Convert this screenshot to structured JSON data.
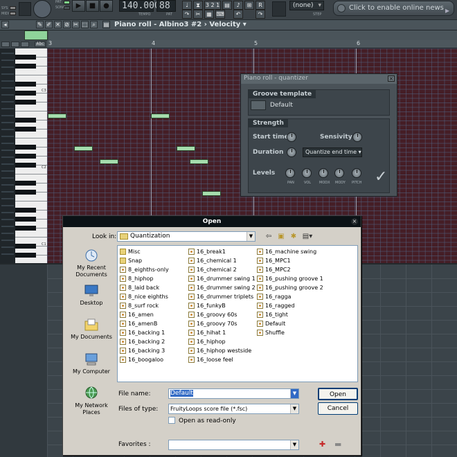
{
  "toolbar": {
    "labels": [
      "SYS",
      "MIDI",
      "PAT",
      "SONG",
      "TEMPO",
      "PAT"
    ],
    "tempo": "140.000",
    "pattern": "88",
    "pattern_tool_label": "3 2 1",
    "pattern_tool_label2": "R",
    "controller_select": "(none)",
    "news": "Click to enable online news",
    "step_label": "STEP"
  },
  "piano_roll": {
    "title": "Piano roll - Albino3 #2",
    "target": "Velocity",
    "bar_numbers": [
      "3",
      "4",
      "5",
      "6"
    ],
    "octave_labels": [
      "C3",
      "C2",
      "C1"
    ],
    "snap_label": "Abc",
    "accent_color": "#a6dcad"
  },
  "quantizer": {
    "title": "Piano roll - quantizer",
    "groove_header": "Groove template",
    "groove_value": "Default",
    "strength_header": "Strength",
    "start_time": "Start time",
    "sensivity": "Sensivity",
    "duration": "Duration",
    "quantize_mode": "Quantize end time",
    "levels": "Levels",
    "knob_labels": [
      "PAN",
      "VOL",
      "MODX",
      "MODY",
      "PITCH"
    ],
    "confirm_icon": "checkmark-icon"
  },
  "open_dialog": {
    "title": "Open",
    "look_in_label": "Look in:",
    "look_in_value": "Quantization",
    "places": [
      "My Recent Documents",
      "Desktop",
      "My Documents",
      "My Computer",
      "My Network Places"
    ],
    "columns": [
      [
        "Misc",
        "Snap",
        "8_eighths-only",
        "8_hiphop",
        "8_laid back",
        "8_nice eighths",
        "8_surf rock",
        "16_amen",
        "16_amenB",
        "16_backing 1",
        "16_backing 2",
        "16_backing 3",
        "16_boogaloo"
      ],
      [
        "16_break1",
        "16_chemical 1",
        "16_chemical 2",
        "16_drummer swing 1",
        "16_drummer swing 2",
        "16_drummer triplets",
        "16_funkyB",
        "16_groovy 60s",
        "16_groovy 70s",
        "16_hihat 1",
        "16_hiphop",
        "16_hiphop westside",
        "16_loose feel"
      ],
      [
        "16_machine swing",
        "16_MPC1",
        "16_MPC2",
        "16_pushing groove 1",
        "16_pushing groove 2",
        "16_ragga",
        "16_ragged",
        "16_tight",
        "Default",
        "Shuffle"
      ]
    ],
    "file_name_label": "File name:",
    "file_name_value": "Default",
    "file_type_label": "Files of type:",
    "file_type_value": "FruityLoops score file (*.fsc)",
    "read_only_label": "Open as read-only",
    "favorites_label": "Favorites :",
    "open_button": "Open",
    "cancel_button": "Cancel"
  }
}
